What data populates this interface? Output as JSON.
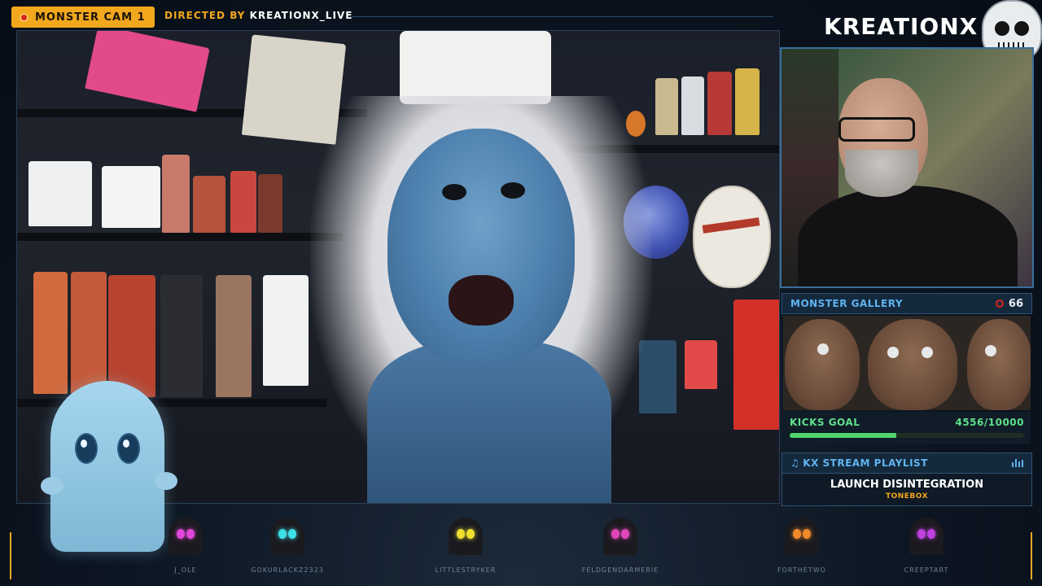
{
  "topbar": {
    "cam_label": "MONSTER CAM 1",
    "directed_by_label": "DIRECTED BY",
    "director": "KREATIONX_LIVE"
  },
  "brand": {
    "name": "KREATIONX",
    "logo_icon": "skull-icon"
  },
  "gallery": {
    "title": "MONSTER GALLERY",
    "viewer_count": "66"
  },
  "goal": {
    "label": "KICKS GOAL",
    "progress_text": "4556/10000",
    "current": 4556,
    "target": 10000
  },
  "playlist": {
    "title": "KX STREAM PLAYLIST",
    "track": "LAUNCH DISINTEGRATION",
    "artist": "TONEBOX"
  },
  "chatters": [
    {
      "name": "J_OLE",
      "eye_color": "#e046d8"
    },
    {
      "name": "GOKURLACKZ2323",
      "eye_color": "#3ee0e8"
    },
    {
      "name": "LITTLESTRYKER",
      "eye_color": "#f0e030"
    },
    {
      "name": "FELDGENDARMERIE",
      "eye_color": "#e046b8"
    },
    {
      "name": "FORTHETWO",
      "eye_color": "#f08a2a"
    },
    {
      "name": "CREEPTART",
      "eye_color": "#c040e0"
    }
  ],
  "colors": {
    "accent": "#f2a81d",
    "panel_title": "#5fb4f0",
    "goal_green": "#52d46f"
  }
}
